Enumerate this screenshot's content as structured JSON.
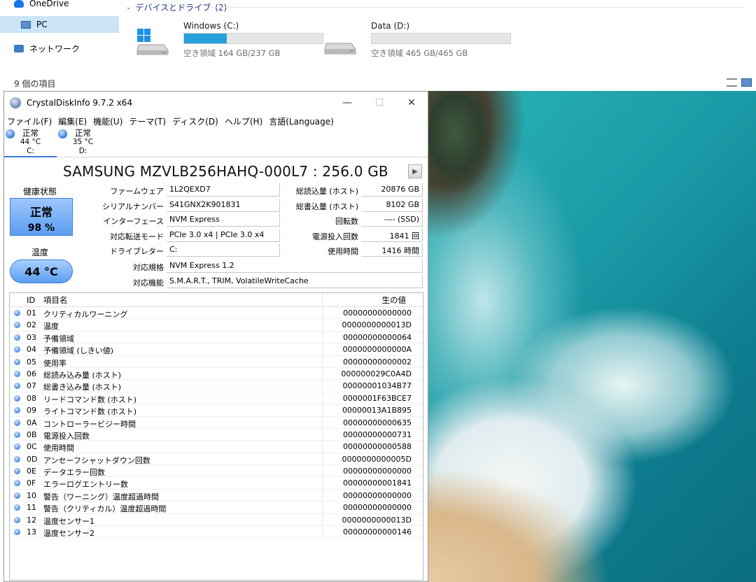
{
  "explorer": {
    "nav": [
      {
        "label": "OneDrive",
        "icon": "cloud-icon"
      },
      {
        "label": "PC",
        "icon": "pc-icon",
        "selected": true
      },
      {
        "label": "ネットワーク",
        "icon": "network-icon"
      }
    ],
    "section": {
      "title": "デバイスとドライブ",
      "count": "(2)"
    },
    "drives": [
      {
        "name": "Windows (C:)",
        "free_text": "空き領域 164 GB/237 GB",
        "used_fraction": 0.31
      },
      {
        "name": "Data (D:)",
        "free_text": "空き領域 465 GB/465 GB",
        "used_fraction": 0.0
      }
    ],
    "status": "9 個の項目"
  },
  "cdi": {
    "title": "CrystalDiskInfo 9.7.2 x64",
    "menu": [
      "ファイル(F)",
      "編集(E)",
      "機能(U)",
      "テーマ(T)",
      "ディスク(D)",
      "ヘルプ(H)",
      "言語(Language)"
    ],
    "disks": [
      {
        "status": "正常",
        "temp": "44 °C",
        "letter": "C:"
      },
      {
        "status": "正常",
        "temp": "35 °C",
        "letter": "D:"
      }
    ],
    "model": "SAMSUNG MZVLB256HAHQ-000L7 : 256.0 GB",
    "health": {
      "label": "健康状態",
      "status": "正常",
      "percent": "98 %"
    },
    "temperature": {
      "label": "温度",
      "value": "44 °C"
    },
    "info_left": [
      {
        "label": "ファームウェア",
        "value": "1L2QEXD7"
      },
      {
        "label": "シリアルナンバー",
        "value": "S41GNX2K901831"
      },
      {
        "label": "インターフェース",
        "value": "NVM Express"
      },
      {
        "label": "対応転送モード",
        "value": "PCIe 3.0 x4 | PCIe 3.0 x4"
      },
      {
        "label": "ドライブレター",
        "value": "C:"
      }
    ],
    "info_right": [
      {
        "label": "総読込量 (ホスト)",
        "value": "20876 GB"
      },
      {
        "label": "総書込量 (ホスト)",
        "value": "8102 GB"
      },
      {
        "label": "回転数",
        "value": "---- (SSD)"
      },
      {
        "label": "電源投入回数",
        "value": "1841 回"
      },
      {
        "label": "使用時間",
        "value": "1416 時間"
      }
    ],
    "info_wide": [
      {
        "label": "対応規格",
        "value": "NVM Express 1.2"
      },
      {
        "label": "対応機能",
        "value": "S.M.A.R.T., TRIM, VolatileWriteCache"
      }
    ],
    "smart_headers": {
      "id": "ID",
      "name": "項目名",
      "raw": "生の値"
    },
    "smart": [
      {
        "id": "01",
        "name": "クリティカルワーニング",
        "raw": "00000000000000"
      },
      {
        "id": "02",
        "name": "温度",
        "raw": "0000000000013D"
      },
      {
        "id": "03",
        "name": "予備領域",
        "raw": "00000000000064"
      },
      {
        "id": "04",
        "name": "予備領域 (しきい値)",
        "raw": "0000000000000A"
      },
      {
        "id": "05",
        "name": "使用率",
        "raw": "00000000000002"
      },
      {
        "id": "06",
        "name": "総読み込み量 (ホスト)",
        "raw": "000000029C0A4D"
      },
      {
        "id": "07",
        "name": "総書き込み量 (ホスト)",
        "raw": "00000001034B77"
      },
      {
        "id": "08",
        "name": "リードコマンド数 (ホスト)",
        "raw": "0000001F63BCE7"
      },
      {
        "id": "09",
        "name": "ライトコマンド数 (ホスト)",
        "raw": "00000013A1B895"
      },
      {
        "id": "0A",
        "name": "コントローラービジー時間",
        "raw": "00000000000635"
      },
      {
        "id": "0B",
        "name": "電源投入回数",
        "raw": "00000000000731"
      },
      {
        "id": "0C",
        "name": "使用時間",
        "raw": "00000000000588"
      },
      {
        "id": "0D",
        "name": "アンセーフシャットダウン回数",
        "raw": "0000000000005D"
      },
      {
        "id": "0E",
        "name": "データエラー回数",
        "raw": "00000000000000"
      },
      {
        "id": "0F",
        "name": "エラーログエントリー数",
        "raw": "00000000001841"
      },
      {
        "id": "10",
        "name": "警告（ワーニング）温度超過時間",
        "raw": "00000000000000"
      },
      {
        "id": "11",
        "name": "警告（クリティカル）温度超過時間",
        "raw": "00000000000000"
      },
      {
        "id": "12",
        "name": "温度センサー1",
        "raw": "0000000000013D"
      },
      {
        "id": "13",
        "name": "温度センサー2",
        "raw": "00000000000146"
      }
    ]
  }
}
